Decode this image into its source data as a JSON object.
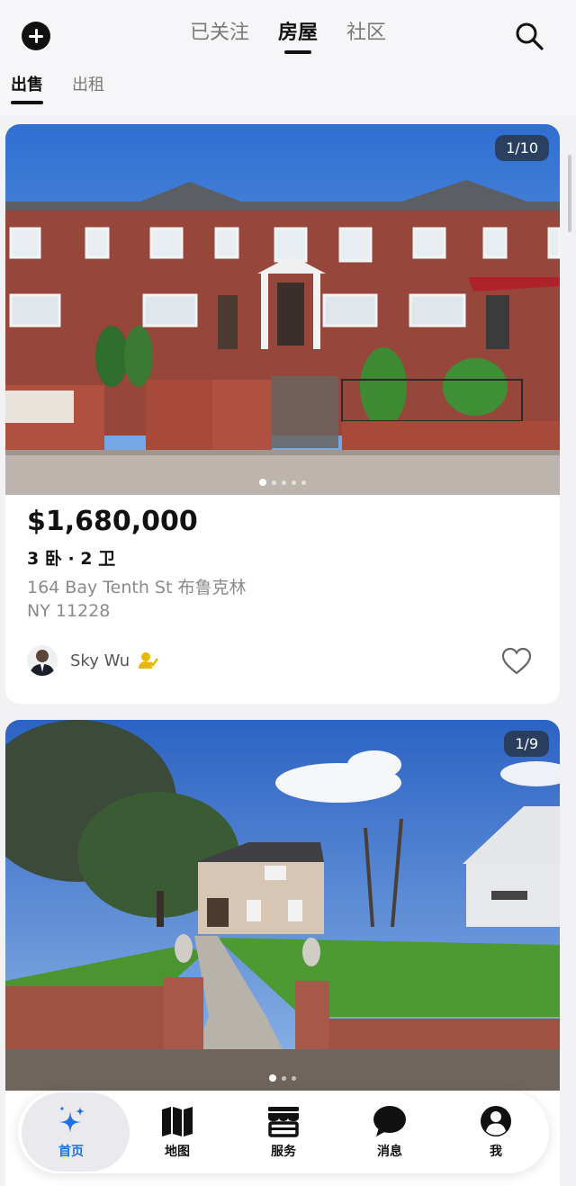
{
  "header": {
    "tabs": [
      {
        "label": "已关注",
        "active": false
      },
      {
        "label": "房屋",
        "active": true
      },
      {
        "label": "社区",
        "active": false
      }
    ],
    "sub_tabs": [
      {
        "label": "出售",
        "active": true
      },
      {
        "label": "出租",
        "active": false
      }
    ]
  },
  "listings": [
    {
      "photo_counter": "1/10",
      "price": "$1,680,000",
      "rooms": "3 卧 · 2 卫",
      "address_line1": "164 Bay Tenth St 布鲁克林",
      "address_line2": "NY  11228",
      "agent_name": "Sky Wu"
    },
    {
      "photo_counter": "1/9"
    }
  ],
  "bottom_nav": [
    {
      "label": "首页",
      "icon": "sparkle-icon",
      "active": true
    },
    {
      "label": "地图",
      "icon": "map-icon",
      "active": false
    },
    {
      "label": "服务",
      "icon": "store-icon",
      "active": false
    },
    {
      "label": "消息",
      "icon": "chat-bubble-icon",
      "active": false
    },
    {
      "label": "我",
      "icon": "user-circle-icon",
      "active": false
    }
  ],
  "colors": {
    "accent": "#1f6fe5",
    "badge": "#e6b800"
  }
}
